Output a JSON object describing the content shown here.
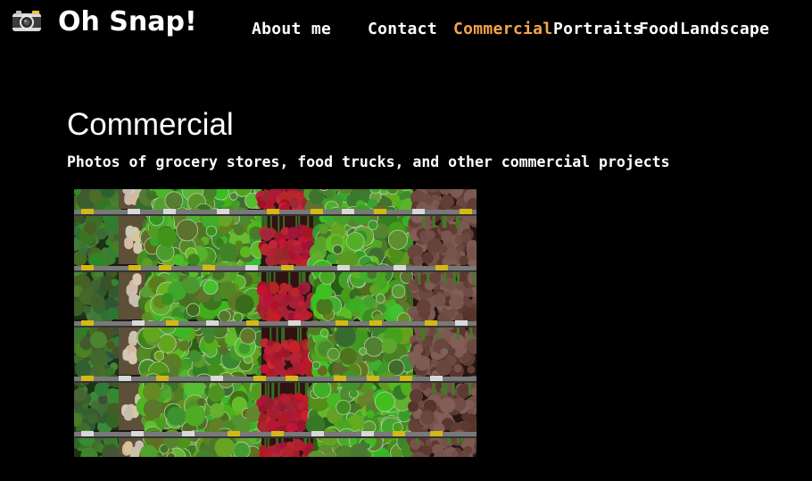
{
  "header": {
    "logo_icon": "camera-icon",
    "brand": "Oh Snap!"
  },
  "nav": {
    "items": [
      {
        "label": "About me"
      },
      {
        "label": "Contact"
      },
      {
        "label": "Commercial"
      },
      {
        "label": "Portraits"
      },
      {
        "label": "Food"
      },
      {
        "label": "Landscape"
      }
    ],
    "active": "Commercial",
    "active_color": "#f5a54a"
  },
  "section": {
    "title": "Commercial",
    "subtitle": "Photos of grocery stores, food trucks, and other commercial projects",
    "photo_subject": "grocery-store-produce-shelves"
  },
  "colors": {
    "background": "#000000",
    "text": "#ffffff",
    "accent": "#f5a54a"
  }
}
